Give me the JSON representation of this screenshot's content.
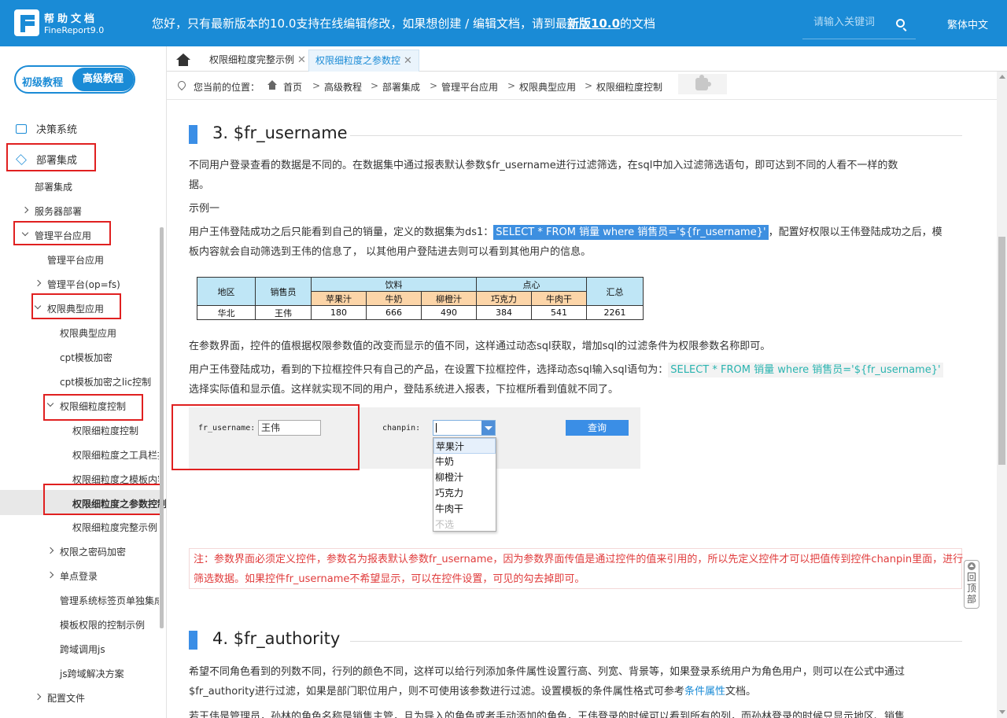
{
  "header": {
    "brand_cn": "帮助文档",
    "brand_en": "FineReport9.0",
    "notice_prefix": "您好，只有最新版本的10.0支持在线编辑修改，如果想创建 / 编辑文档，请到最",
    "notice_link": "新版10.0",
    "notice_suffix": "的文档",
    "search_placeholder": "请输入关键词",
    "lang": "繁体中文"
  },
  "sidebar": {
    "switch_basic": "初级教程",
    "switch_advanced": "高级教程",
    "items": [
      "决策系统",
      "部署集成",
      "部署集成",
      "服务器部署",
      "管理平台应用",
      "管理平台应用",
      "管理平台(op=fs)",
      "权限典型应用",
      "权限典型应用",
      "cpt模板加密",
      "cpt模板加密之lic控制",
      "权限细粒度控制",
      "权限细粒度控制",
      "权限细粒度之工具栏按",
      "权限细粒度之模板内容",
      "权限细粒度之参数控制",
      "权限细粒度完整示例",
      "权限之密码加密",
      "单点登录",
      "管理系统标签页单独集成",
      "模板权限的控制示例",
      "跨域调用js",
      "js跨域解决方案",
      "配置文件"
    ]
  },
  "tabs": [
    "权限细粒度完整示例",
    "权限细粒度之参数控制"
  ],
  "breadcrumb": {
    "label": "您当前的位置：",
    "items": [
      "首页",
      "高级教程",
      "部署集成",
      "管理平台应用",
      "权限典型应用",
      "权限细粒度控制"
    ]
  },
  "content": {
    "h3_1": "3. $fr_username",
    "p1_line1": "不同用户登录查看的数据是不同的。在数据集中通过报表默认参数$fr_username进行过滤筛选，在sql中加入过滤筛选语句，即可达到不同的人看不一样的数",
    "p1_line2": "据。",
    "example": "示例一",
    "p2_pre": "用户王伟登陆成功之后只能看到自己的销量，定义的数据集为ds1：",
    "p2_code": "SELECT * FROM 销量 where 销售员='${fr_username}'",
    "p2_post": "，配置好权限以王伟登陆成功之后，模",
    "p2_line2": "板内容就会自动筛选到王伟的信息了， 以其他用户登陆进去则可以看到其他用户的信息。",
    "p3": "在参数界面，控件的值根据权限参数值的改变而显示的值不同，这样通过动态sql获取，增加sql的过滤条件为权限参数名称即可。",
    "p4_pre": "用户王伟登陆成功，看到的下拉框控件只有自己的产品，在设置下拉框控件，选择动态sql输入sql语句为：",
    "p4_code": "SELECT * FROM 销量 where 销售员='${fr_username}'",
    "p4_line2": "选择实际值和显示值。这样就实现不同的用户，登陆系统进入报表，下拉框所看到值就不同了。",
    "note_line1": "注：参数界面必须定义控件，参数名为报表默认参数fr_username，因为参数界面传值是通过控件的值来引用的，所以先定义控件才可以把值传到控件chanpin里面，进行",
    "note_line2": "筛选数据。如果控件fr_username不希望显示，可以在控件设置，可见的勾去掉即可。",
    "h3_2": "4. $fr_authority",
    "p5_line1": "希望不同角色看到的列数不同，行列的颜色不同，这样可以给行列添加条件属性设置行高、列宽、背景等，如果登录系统用户为角色用户，则可以在公式中通过",
    "p5_line2_pre": "$fr_authority进行过滤，如果是部门职位用户，则不可使用该参数进行过滤。设置模板的条件属性格式可参考",
    "p5_link": "条件属性",
    "p5_line2_post": "文档。",
    "p6": "若王伟是管理员，孙林的角色名称是销售主管，且为导入的角色或者手动添加的角色，王伟登录的时候可以看到所有的列，而孙林登录的时候只显示地区、销售"
  },
  "report_table": {
    "h_region": "地区",
    "h_sales": "销售员",
    "h_drinks": "饮料",
    "h_snacks": "点心",
    "h_total": "汇总",
    "sub": [
      "苹果汁",
      "牛奶",
      "柳橙汁",
      "巧克力",
      "牛肉干"
    ],
    "row": [
      "华北",
      "王伟",
      "180",
      "666",
      "490",
      "384",
      "541",
      "2261"
    ]
  },
  "param_panel": {
    "user_label": "fr_username:",
    "user_value": "王伟",
    "chanpin_label": "chanpin:",
    "query": "查询",
    "options": [
      "苹果汁",
      "牛奶",
      "柳橙汁",
      "巧克力",
      "牛肉干",
      "不选"
    ]
  },
  "back_to_top": "回顶部"
}
